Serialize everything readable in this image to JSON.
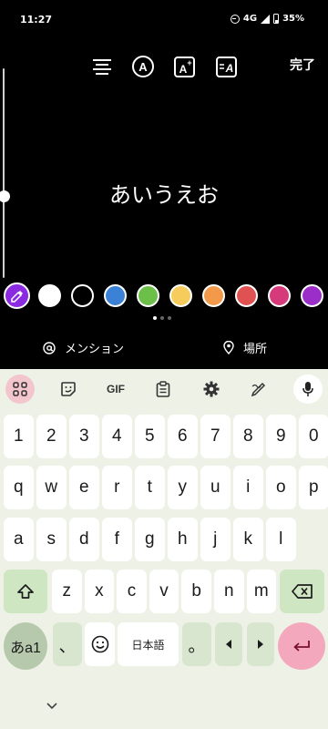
{
  "status_bar": {
    "time": "11:27",
    "network": "4G",
    "battery": "35%"
  },
  "toolbar": {
    "icons": [
      "align-icon",
      "font-style-icon",
      "text-effect-icon",
      "text-animation-icon"
    ],
    "done_label": "完了"
  },
  "editor": {
    "text": "あいうえお"
  },
  "colors": {
    "picker_color": "#8a2be2",
    "swatches": [
      "#ffffff",
      "#000000",
      "#3b82d6",
      "#6cc04a",
      "#f6cd5c",
      "#f2994a",
      "#e05252",
      "#d63a7a",
      "#9b2ec8"
    ]
  },
  "pager": {
    "pages": 3,
    "active": 1
  },
  "actions": {
    "mention_label": "メンション",
    "place_label": "場所"
  },
  "keyboard": {
    "top_icons": [
      "apps-icon",
      "sticker-icon",
      "gif-label",
      "clipboard-icon",
      "gear-icon",
      "handwriting-icon",
      "mic-icon"
    ],
    "gif_label": "GIF",
    "row_numbers": [
      "1",
      "2",
      "3",
      "4",
      "5",
      "6",
      "7",
      "8",
      "9",
      "0"
    ],
    "row_1": [
      "q",
      "w",
      "e",
      "r",
      "t",
      "y",
      "u",
      "i",
      "o",
      "p"
    ],
    "row_2": [
      "a",
      "s",
      "d",
      "f",
      "g",
      "h",
      "j",
      "k",
      "l"
    ],
    "row_3": [
      "z",
      "x",
      "c",
      "v",
      "b",
      "n",
      "m"
    ],
    "bottom": {
      "kana": "あa1",
      "comma": "、",
      "lang": "日本語",
      "period": "。"
    }
  },
  "accent_colors": {
    "apps_bg": "#f2c6cc",
    "enter_bg": "#f4a8bd",
    "keyboard_bg": "#eef2e6"
  }
}
